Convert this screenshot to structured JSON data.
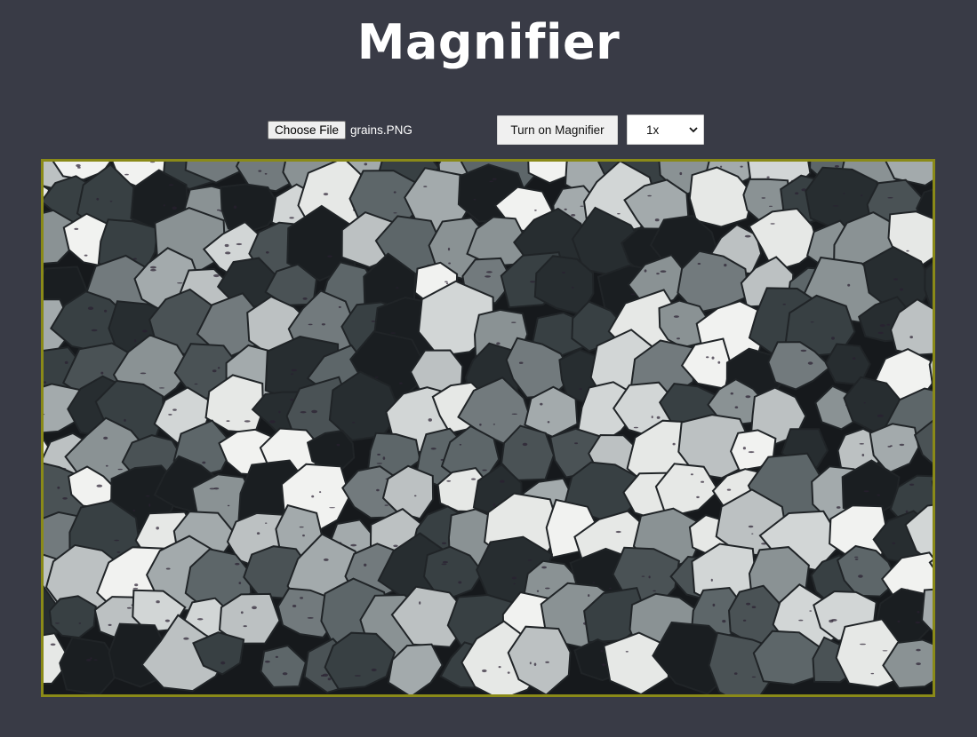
{
  "header": {
    "title": "Magnifier"
  },
  "controls": {
    "choose_file_label": "Choose File",
    "file_name": "grains.PNG",
    "magnifier_button_label": "Turn on Magnifier",
    "zoom_select": {
      "selected": "1x",
      "icon": "chevron-down-icon"
    }
  },
  "image": {
    "name": "grains.PNG",
    "depicts": "thin-section micrograph of mineral grains",
    "frame_color": "#8a8a18"
  },
  "colors": {
    "background": "#393b46",
    "title": "#ffffff"
  }
}
